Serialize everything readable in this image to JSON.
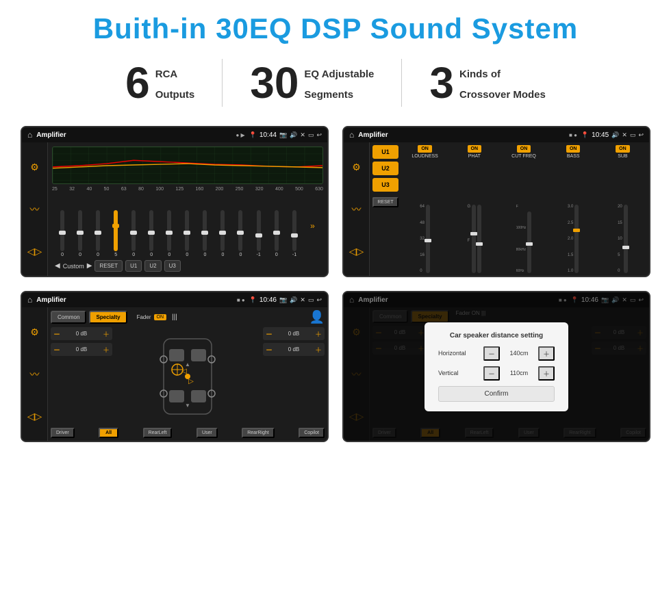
{
  "header": {
    "title": "Buith-in 30EQ DSP Sound System"
  },
  "stats": [
    {
      "number": "6",
      "text_line1": "RCA",
      "text_line2": "Outputs"
    },
    {
      "number": "30",
      "text_line1": "EQ Adjustable",
      "text_line2": "Segments"
    },
    {
      "number": "3",
      "text_line1": "Kinds of",
      "text_line2": "Crossover Modes"
    }
  ],
  "screens": [
    {
      "id": "eq-screen",
      "status_bar": {
        "app": "Amplifier",
        "time": "10:44"
      },
      "type": "equalizer"
    },
    {
      "id": "crossover-screen",
      "status_bar": {
        "app": "Amplifier",
        "time": "10:45"
      },
      "type": "crossover"
    },
    {
      "id": "fader-screen",
      "status_bar": {
        "app": "Amplifier",
        "time": "10:46"
      },
      "type": "fader"
    },
    {
      "id": "dialog-screen",
      "status_bar": {
        "app": "Amplifier",
        "time": "10:46"
      },
      "type": "dialog",
      "dialog": {
        "title": "Car speaker distance setting",
        "horizontal_label": "Horizontal",
        "horizontal_value": "140cm",
        "vertical_label": "Vertical",
        "vertical_value": "110cm",
        "confirm_label": "Confirm"
      }
    }
  ],
  "eq": {
    "frequencies": [
      "25",
      "32",
      "40",
      "50",
      "63",
      "80",
      "100",
      "125",
      "160",
      "200",
      "250",
      "320",
      "400",
      "500",
      "630"
    ],
    "values": [
      "0",
      "0",
      "0",
      "5",
      "0",
      "0",
      "0",
      "0",
      "0",
      "0",
      "0",
      "-1",
      "0",
      "-1"
    ],
    "presets": [
      "Custom",
      "RESET",
      "U1",
      "U2",
      "U3"
    ]
  },
  "crossover": {
    "units": [
      "U1",
      "U2",
      "U3"
    ],
    "channels": [
      "LOUDNESS",
      "PHAT",
      "CUT FREQ",
      "BASS",
      "SUB"
    ]
  },
  "fader": {
    "tabs": [
      "Common",
      "Specialty"
    ],
    "active_tab": "Specialty",
    "fader_label": "Fader",
    "buttons": [
      "Driver",
      "All",
      "RearLeft",
      "User",
      "RearRight",
      "Copilot"
    ]
  },
  "dialog": {
    "title": "Car speaker distance setting",
    "confirm": "Confirm",
    "horizontal": "140cm",
    "vertical": "110cm"
  }
}
